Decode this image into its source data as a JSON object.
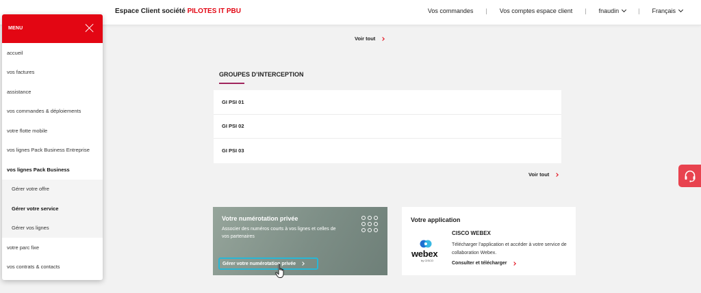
{
  "header": {
    "brand_prefix": "Espace Client société",
    "company": "PILOTES IT PBU",
    "nav": {
      "orders": "Vos commandes",
      "accounts": "Vos comptes espace client",
      "user": "fnaudin",
      "language": "Français"
    }
  },
  "menu": {
    "title": "MENU",
    "items": [
      "accueil",
      "vos factures",
      "assistance",
      "vos commandes & déploiements",
      "votre flotte mobile",
      "vos lignes Pack Business Entreprise",
      "vos lignes Pack Business"
    ],
    "sub_items": [
      "Gérer votre offre",
      "Gérer votre service",
      "Gérer vos lignes"
    ],
    "items_after": [
      "votre parc fixe",
      "vos contrats & contacts"
    ]
  },
  "main": {
    "see_all_top": "Voir tout",
    "intercept": {
      "title": "GROUPES D’INTERCEPTION",
      "groups": [
        "GI PSI 01",
        "GI PSI 02",
        "GI PSI 03"
      ],
      "see_all": "Voir tout"
    },
    "promo": {
      "title": "Votre numérotation privée",
      "description": "Associer des numéros courts à vos lignes et celles de vos partenaires",
      "button": "Gérer votre numérotation privée"
    },
    "app": {
      "title": "Votre application",
      "name": "CISCO WEBEX",
      "description": "Télécharger l’application et accéder à votre service de collaboration Webex.",
      "link": "Consulter et télécharger",
      "logo_word": "webex",
      "logo_by": "by CISCO"
    }
  },
  "colors": {
    "accent_red": "#e30613",
    "underline": "#a0245c",
    "focus_ring": "#27b7d6",
    "support_button": "#e8434f"
  }
}
